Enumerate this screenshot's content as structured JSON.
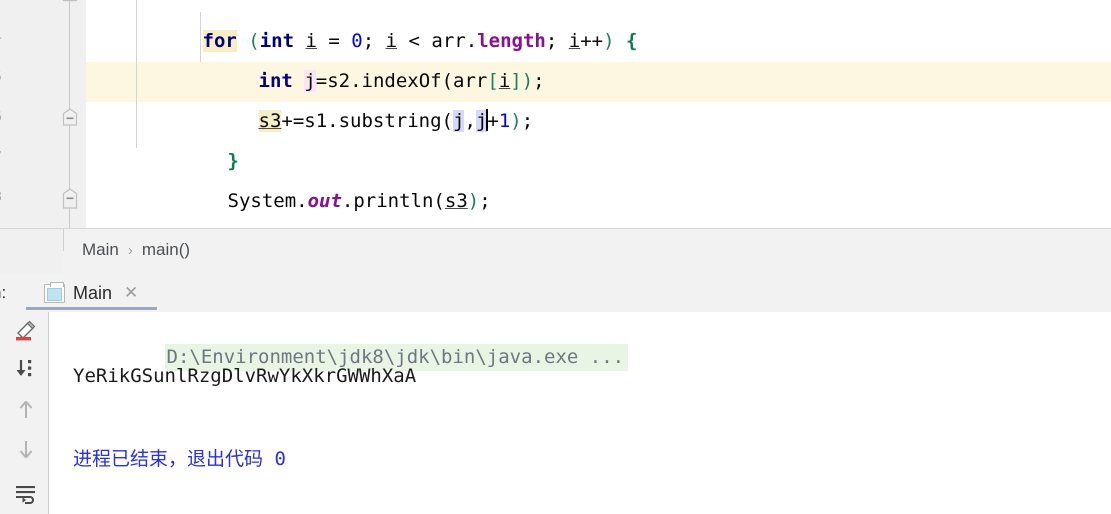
{
  "editor": {
    "language": "java",
    "lines": [
      {
        "n": "",
        "text": "for (int i = 0; i < arr.length; i++) {"
      },
      {
        "n": "",
        "text": "int j=s2.indexOf(arr[i]);"
      },
      {
        "n": "",
        "text": "s3+=s1.substring(j,j+1);"
      },
      {
        "n": "",
        "text": "}"
      },
      {
        "n": "",
        "text": "System.out.println(s3);"
      },
      {
        "n": "",
        "text": "}"
      }
    ],
    "tokens": {
      "kw_for": "for",
      "kw_int": "int",
      "line1_rest_a": " (",
      "line1_i1": "i",
      "line1_eq": " = ",
      "line1_zero": "0",
      "line1_semi1": "; ",
      "line1_i2": "i",
      "line1_lt": " < ",
      "line1_arr": "arr",
      "line1_dot": ".",
      "line1_length": "length",
      "line1_semi2": "; ",
      "line1_i3": "i",
      "line1_inc": "++",
      "line1_close": ") ",
      "line1_brace": "{",
      "line2_sp": " ",
      "line2_j": "j",
      "line2_eq": "=s2.indexOf(",
      "line2_arr": "arr",
      "line2_lb": "[",
      "line2_i": "i",
      "line2_rb": "]",
      "line2_rp": ")",
      "line2_semi": ";",
      "line3_s3": "s3",
      "line3_op": "+=s1.substring(",
      "line3_j1": "j",
      "line3_comma": ",",
      "line3_j2": "j",
      "line3_plus": "+",
      "line3_one": "1",
      "line3_rp": ")",
      "line3_semi": ";",
      "line4_brace": "}",
      "line5_system": "System.",
      "line5_out": "out",
      "line5_println": ".println(",
      "line5_s3": "s3",
      "line5_rp": ")",
      "line5_semi": ";",
      "line6_brace": "}"
    },
    "fold_marker": "minus"
  },
  "breadcrumb": {
    "class_name": "Main",
    "separator": "›",
    "method_name": "main()"
  },
  "run_panel": {
    "label": "n:",
    "tab_name": "Main",
    "tab_close": "✕",
    "tab_icon": "run-configuration-icon",
    "toolbar_icons": [
      {
        "name": "clear-all-icon",
        "tooltip": "Clear All"
      },
      {
        "name": "scroll-to-end-icon",
        "tooltip": "Scroll to End"
      },
      {
        "name": "up-arrow-icon",
        "tooltip": "Previous Occurrence"
      },
      {
        "name": "down-arrow-icon",
        "tooltip": "Next Occurrence"
      },
      {
        "name": "soft-wrap-icon",
        "tooltip": "Soft-Wrap"
      }
    ],
    "console": {
      "command_line": "D:\\Environment\\jdk8\\jdk\\bin\\java.exe ...",
      "stdout": "YeRikGSunlRzgDlvRwYkXkrGWWhXaA",
      "exit_message": "进程已结束，退出代码 0"
    }
  },
  "colors": {
    "keyword": "#000080",
    "number": "#0000ff",
    "field": "#871094",
    "paren": "#1a7f5a",
    "caret_line": "#fdf7e2",
    "identifier_highlight": "#f7eec4",
    "usage_highlight": "#d6d9f7",
    "write_highlight": "#fbe4f5",
    "console_command_bg": "#e9f5e4",
    "exit_text": "#2a31d8",
    "clear_icon": "#cf4a3d"
  }
}
